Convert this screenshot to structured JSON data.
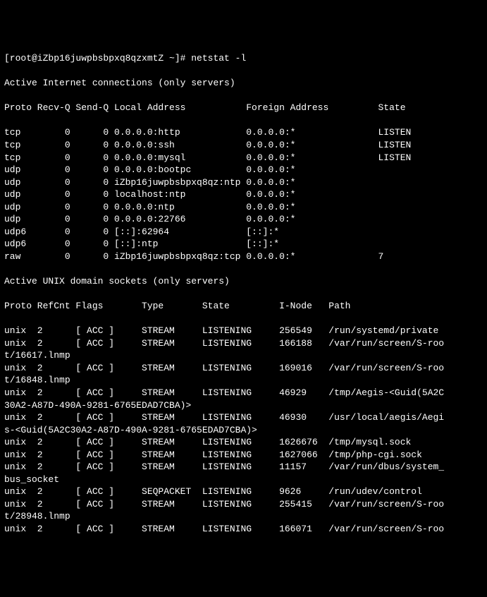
{
  "prompt": "[root@iZbp16juwpbsbpxq8qzxmtZ ~]# ",
  "command": "netstat -l",
  "header1": "Active Internet connections (only servers)",
  "inet_cols": "Proto Recv-Q Send-Q Local Address           Foreign Address         State      ",
  "inet_rows": [
    "tcp        0      0 0.0.0.0:http            0.0.0.0:*               LISTEN     ",
    "tcp        0      0 0.0.0.0:ssh             0.0.0.0:*               LISTEN     ",
    "tcp        0      0 0.0.0.0:mysql           0.0.0.0:*               LISTEN     ",
    "udp        0      0 0.0.0.0:bootpc          0.0.0.0:*                          ",
    "udp        0      0 iZbp16juwpbsbpxq8qz:ntp 0.0.0.0:*                          ",
    "udp        0      0 localhost:ntp           0.0.0.0:*                          ",
    "udp        0      0 0.0.0.0:ntp             0.0.0.0:*                          ",
    "udp        0      0 0.0.0.0:22766           0.0.0.0:*                          ",
    "udp6       0      0 [::]:62964              [::]:*                             ",
    "udp6       0      0 [::]:ntp                [::]:*                             ",
    "raw        0      0 iZbp16juwpbsbpxq8qz:tcp 0.0.0.0:*               7          "
  ],
  "header2": "Active UNIX domain sockets (only servers)",
  "unix_cols": "Proto RefCnt Flags       Type       State         I-Node   Path",
  "unix_rows": [
    "unix  2      [ ACC ]     STREAM     LISTENING     256549   /run/systemd/private",
    "unix  2      [ ACC ]     STREAM     LISTENING     166188   /var/run/screen/S-roo",
    "t/16617.lnmp",
    "unix  2      [ ACC ]     STREAM     LISTENING     169016   /var/run/screen/S-roo",
    "t/16848.lnmp",
    "unix  2      [ ACC ]     STREAM     LISTENING     46929    /tmp/Aegis-<Guid(5A2C",
    "30A2-A87D-490A-9281-6765EDAD7CBA)>",
    "unix  2      [ ACC ]     STREAM     LISTENING     46930    /usr/local/aegis/Aegi",
    "s-<Guid(5A2C30A2-A87D-490A-9281-6765EDAD7CBA)>",
    "unix  2      [ ACC ]     STREAM     LISTENING     1626676  /tmp/mysql.sock",
    "unix  2      [ ACC ]     STREAM     LISTENING     1627066  /tmp/php-cgi.sock",
    "unix  2      [ ACC ]     STREAM     LISTENING     11157    /var/run/dbus/system_",
    "bus_socket",
    "unix  2      [ ACC ]     SEQPACKET  LISTENING     9626     /run/udev/control",
    "unix  2      [ ACC ]     STREAM     LISTENING     255415   /var/run/screen/S-roo",
    "t/28948.lnmp",
    "unix  2      [ ACC ]     STREAM     LISTENING     166071   /var/run/screen/S-roo"
  ]
}
